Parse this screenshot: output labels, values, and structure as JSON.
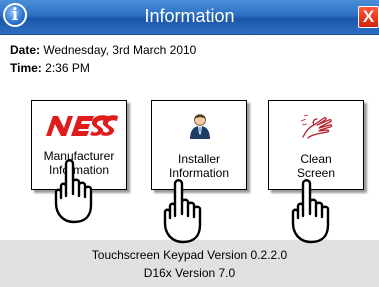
{
  "window": {
    "title": "Information",
    "close_glyph": "X",
    "info_glyph": "i"
  },
  "details": {
    "date_label": "Date:",
    "date_value": "Wednesday, 3rd March 2010",
    "time_label": "Time:",
    "time_value": "2:36 PM"
  },
  "tiles": [
    {
      "icon": "ness-logo-icon",
      "line1": "Manufacturer",
      "line2": "Information"
    },
    {
      "icon": "installer-person-icon",
      "line1": "Installer",
      "line2": "Information"
    },
    {
      "icon": "cleaning-hand-icon",
      "line1": "Clean",
      "line2": "Screen"
    }
  ],
  "footer": {
    "version_line1": "Touchscreen Keypad Version 0.2.2.0",
    "version_line2": "D16x Version 7.0"
  },
  "colors": {
    "titlebar": "#2b6fc2",
    "close": "#d2200c",
    "connector": "#6b8cc7",
    "footer": "#e1e1e1",
    "ness_red": "#e01b1b"
  }
}
